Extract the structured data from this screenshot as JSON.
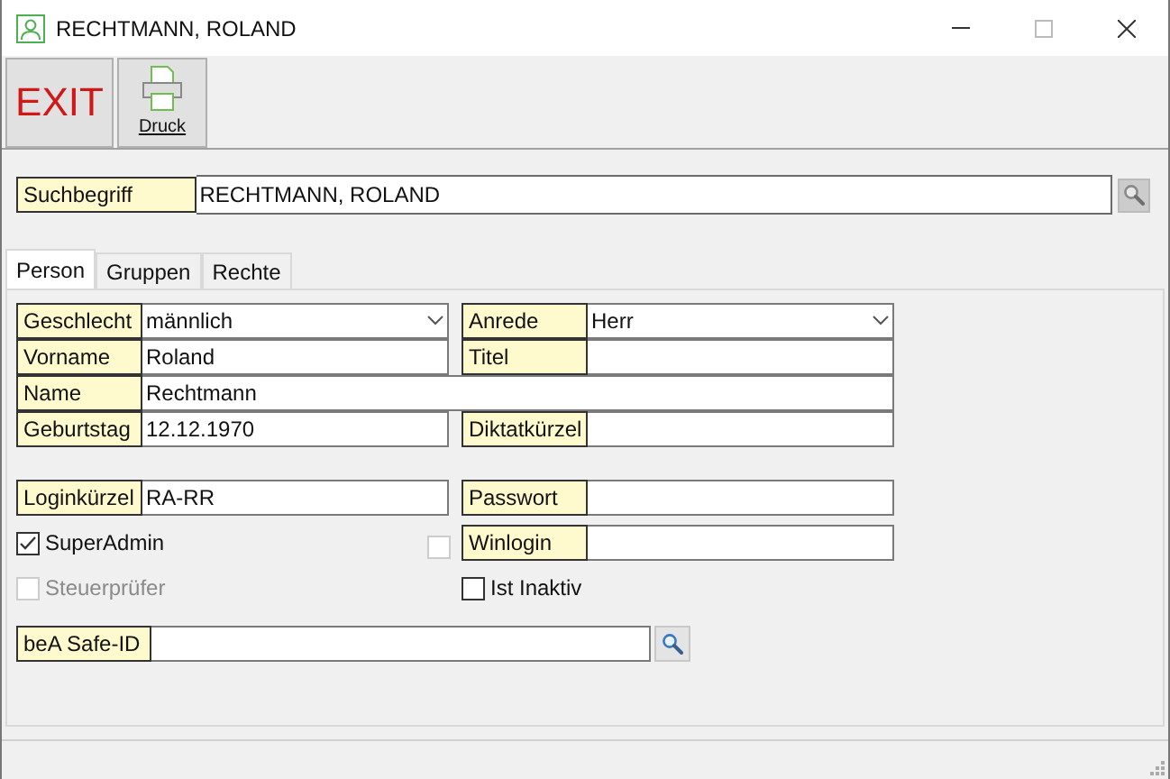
{
  "window": {
    "title": "RECHTMANN, ROLAND"
  },
  "toolbar": [
    {
      "kind": "text",
      "label": "EXIT"
    },
    {
      "kind": "printer",
      "label": "Druck"
    }
  ],
  "search": {
    "label": "Suchbegriff",
    "value": "RECHTMANN, ROLAND"
  },
  "tabs": [
    {
      "label": "Person",
      "selected": true
    },
    {
      "label": "Gruppen",
      "selected": false
    },
    {
      "label": "Rechte",
      "selected": false
    }
  ],
  "sections": [
    [
      {
        "kind": "select",
        "label": "Geschlecht",
        "value": "männlich"
      },
      {
        "kind": "select",
        "label": "Anrede",
        "value": "Herr"
      },
      {
        "kind": "field",
        "label": "Vorname",
        "value": "Roland"
      },
      {
        "kind": "field",
        "label": "Titel"
      },
      {
        "kind": "field",
        "label": "Name",
        "value": "Rechtmann",
        "wide": true
      },
      {
        "kind": "field",
        "label": "Geburtstag",
        "value": "12.12.1970"
      },
      {
        "kind": "field",
        "label": "Diktatkürzel"
      }
    ],
    [
      {
        "kind": "field",
        "label": "Loginkürzel",
        "value": "RA-RR"
      },
      {
        "kind": "field",
        "label": "Passwort"
      },
      {
        "kind": "checkbox",
        "label": "SuperAdmin",
        "checked": true,
        "disabled": false
      },
      {
        "kind": "toggle_field",
        "label": "Winlogin",
        "checked": false,
        "disabled": true
      },
      {
        "kind": "checkbox",
        "label": "Steuerprüfer",
        "checked": false,
        "disabled": true
      },
      {
        "kind": "checkbox",
        "label": "Ist Inaktiv",
        "checked": false,
        "disabled": false
      }
    ],
    [
      {
        "kind": "lookup",
        "label": "beA Safe-ID"
      }
    ]
  ]
}
